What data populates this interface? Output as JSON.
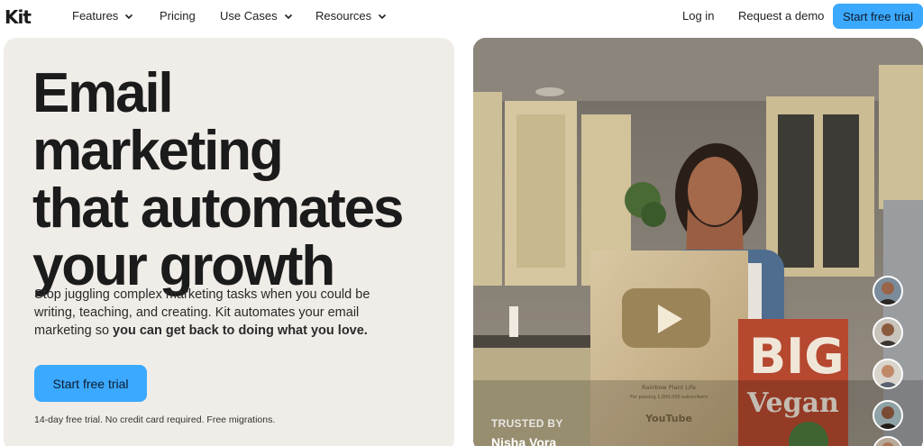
{
  "nav": {
    "logo": "Kit",
    "items": [
      {
        "label": "Features",
        "has_menu": true
      },
      {
        "label": "Pricing",
        "has_menu": false
      },
      {
        "label": "Use Cases",
        "has_menu": true
      },
      {
        "label": "Resources",
        "has_menu": true
      }
    ],
    "login": "Log in",
    "demo": "Request a demo",
    "cta": "Start free trial"
  },
  "hero": {
    "headline_line1": "Email marketing",
    "headline_line2": "that automates",
    "headline_line3": "your growth",
    "sub_regular": "Stop juggling complex marketing tasks when you could be writing, teaching, and creating. Kit automates your email marketing so ",
    "sub_bold": "you can get back to doing what you love.",
    "cta": "Start free trial",
    "fine_print": "14-day free trial. No credit card required. Free migrations."
  },
  "testimonial": {
    "trusted_label": "TRUSTED BY",
    "name": "Nisha Vora",
    "plaque_text": "Rainbow Plant Life",
    "plaque_sub": "For passing 1,000,000 subscribers",
    "plaque_brand": "YouTube",
    "book_title_1": "BIG",
    "book_title_2": "Vegan"
  },
  "colors": {
    "accent": "#3ba9ff",
    "panel_bg": "#f0ede8"
  }
}
